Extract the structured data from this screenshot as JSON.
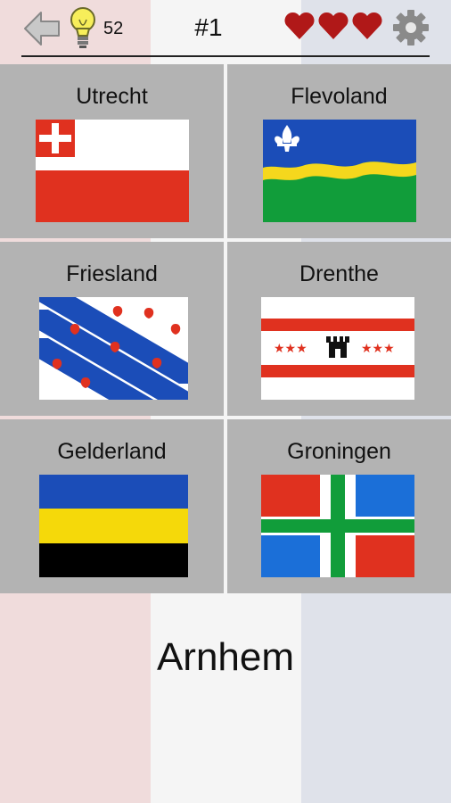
{
  "header": {
    "hint_count": "52",
    "question_number": "#1",
    "lives": 3,
    "icons": [
      "back-arrow-icon",
      "lightbulb-icon",
      "heart-icon",
      "gear-icon"
    ]
  },
  "options": [
    {
      "label": "Utrecht"
    },
    {
      "label": "Flevoland"
    },
    {
      "label": "Friesland"
    },
    {
      "label": "Drenthe"
    },
    {
      "label": "Gelderland"
    },
    {
      "label": "Groningen"
    }
  ],
  "question": {
    "city": "Arnhem"
  },
  "colors": {
    "heart": "#b01818",
    "card_bg": "#b3b3b3"
  }
}
